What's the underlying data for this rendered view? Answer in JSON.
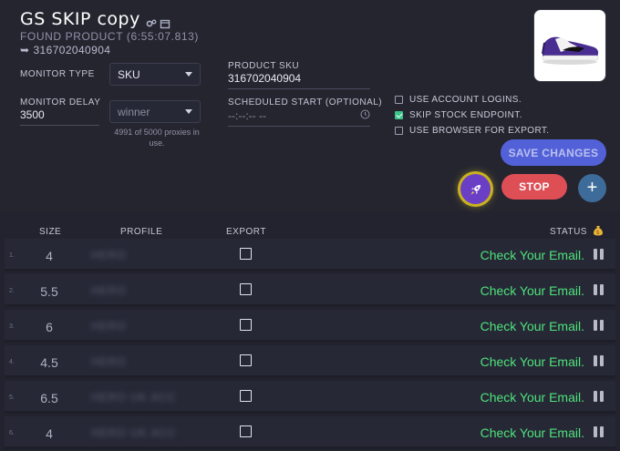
{
  "task": {
    "title": "GS SKIP copy",
    "found_text": "FOUND PRODUCT (6:55:07.813)",
    "sku_arrow": "➥",
    "sku_value": "316702040904"
  },
  "form": {
    "monitor_type_label": "MONITOR TYPE",
    "monitor_type_value": "SKU",
    "product_sku_label": "PRODUCT SKU",
    "product_sku_value": "316702040904",
    "monitor_delay_label": "MONITOR DELAY",
    "monitor_delay_value": "3500",
    "proxy_value": "winner",
    "proxies_note": "4991 of 5000 proxies in use.",
    "scheduled_label": "SCHEDULED START (OPTIONAL)",
    "scheduled_placeholder": "--:--:-- --"
  },
  "options": [
    {
      "label": "USE ACCOUNT LOGINS.",
      "checked": false
    },
    {
      "label": "SKIP STOCK ENDPOINT.",
      "checked": true
    },
    {
      "label": "USE BROWSER FOR EXPORT.",
      "checked": false
    }
  ],
  "buttons": {
    "save": "SAVE CHANGES",
    "stop": "STOP",
    "plus": "+"
  },
  "table": {
    "headers": {
      "size": "SIZE",
      "profile": "PROFILE",
      "export": "EXPORT",
      "status": "STATUS"
    },
    "rows": [
      {
        "num": "1.",
        "size": "4",
        "profile": "HERO",
        "status": "Check Your Email."
      },
      {
        "num": "2.",
        "size": "5.5",
        "profile": "HERO",
        "status": "Check Your Email."
      },
      {
        "num": "3.",
        "size": "6",
        "profile": "HERO",
        "status": "Check Your Email."
      },
      {
        "num": "4.",
        "size": "4.5",
        "profile": "HERO",
        "status": "Check Your Email."
      },
      {
        "num": "5.",
        "size": "6.5",
        "profile": "HERO UK ACC",
        "status": "Check Your Email."
      },
      {
        "num": "6.",
        "size": "4",
        "profile": "HERO UK ACC",
        "status": "Check Your Email."
      }
    ]
  },
  "colors": {
    "accent_green": "#4ee27a",
    "save_blue": "#5361d8",
    "stop_red": "#dd4e55",
    "rocket_purple": "#6a3fc6"
  }
}
